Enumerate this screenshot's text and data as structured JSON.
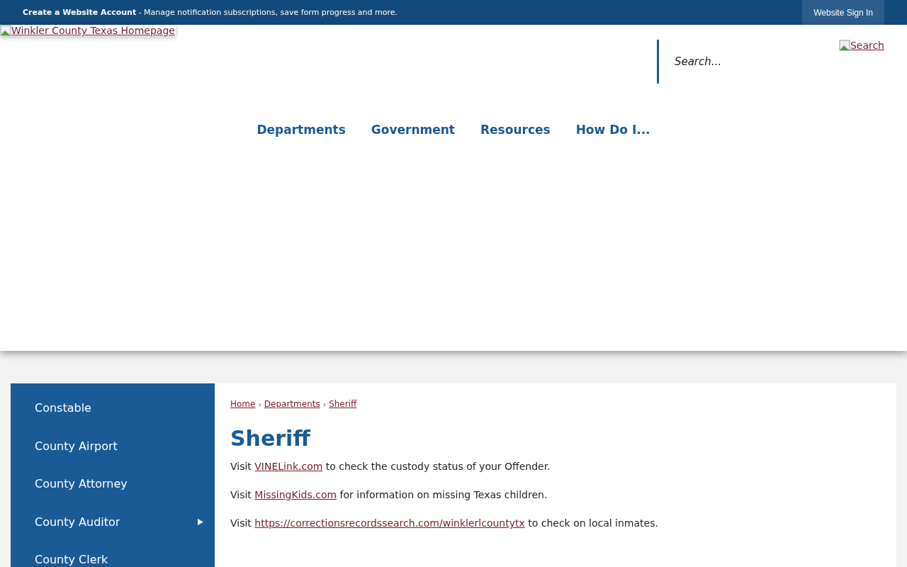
{
  "top_bar": {
    "title": "Create a Website Account",
    "message": " - Manage notification subscriptions, save form progress and more.",
    "sign_in": "Website Sign In"
  },
  "header": {
    "logo_alt": "Winkler County Texas Homepage",
    "search": {
      "placeholder": "Search...",
      "button_alt": "Search"
    }
  },
  "nav": [
    "Departments",
    "Government",
    "Resources",
    "How Do I..."
  ],
  "sidebar": {
    "items": [
      {
        "label": "Constable",
        "has_submenu": false
      },
      {
        "label": "County Airport",
        "has_submenu": false
      },
      {
        "label": "County Attorney",
        "has_submenu": false
      },
      {
        "label": "County Auditor",
        "has_submenu": true
      },
      {
        "label": "County Clerk",
        "has_submenu": false
      }
    ]
  },
  "breadcrumbs": [
    "Home",
    "Departments",
    "Sheriff"
  ],
  "breadcrumb_separator": "›",
  "title": "Sheriff",
  "paragraphs": [
    {
      "before": "Visit ",
      "link": "VINELink.com",
      "after": " to check the custody status of your Offender."
    },
    {
      "before": "Visit ",
      "link": "MissingKids.com",
      "after": " for information on missing Texas children."
    },
    {
      "before": "Visit ",
      "link": "https://correctionsrecordssearch.com/winklerlcountytx",
      "after": " to check on local inmates."
    }
  ]
}
